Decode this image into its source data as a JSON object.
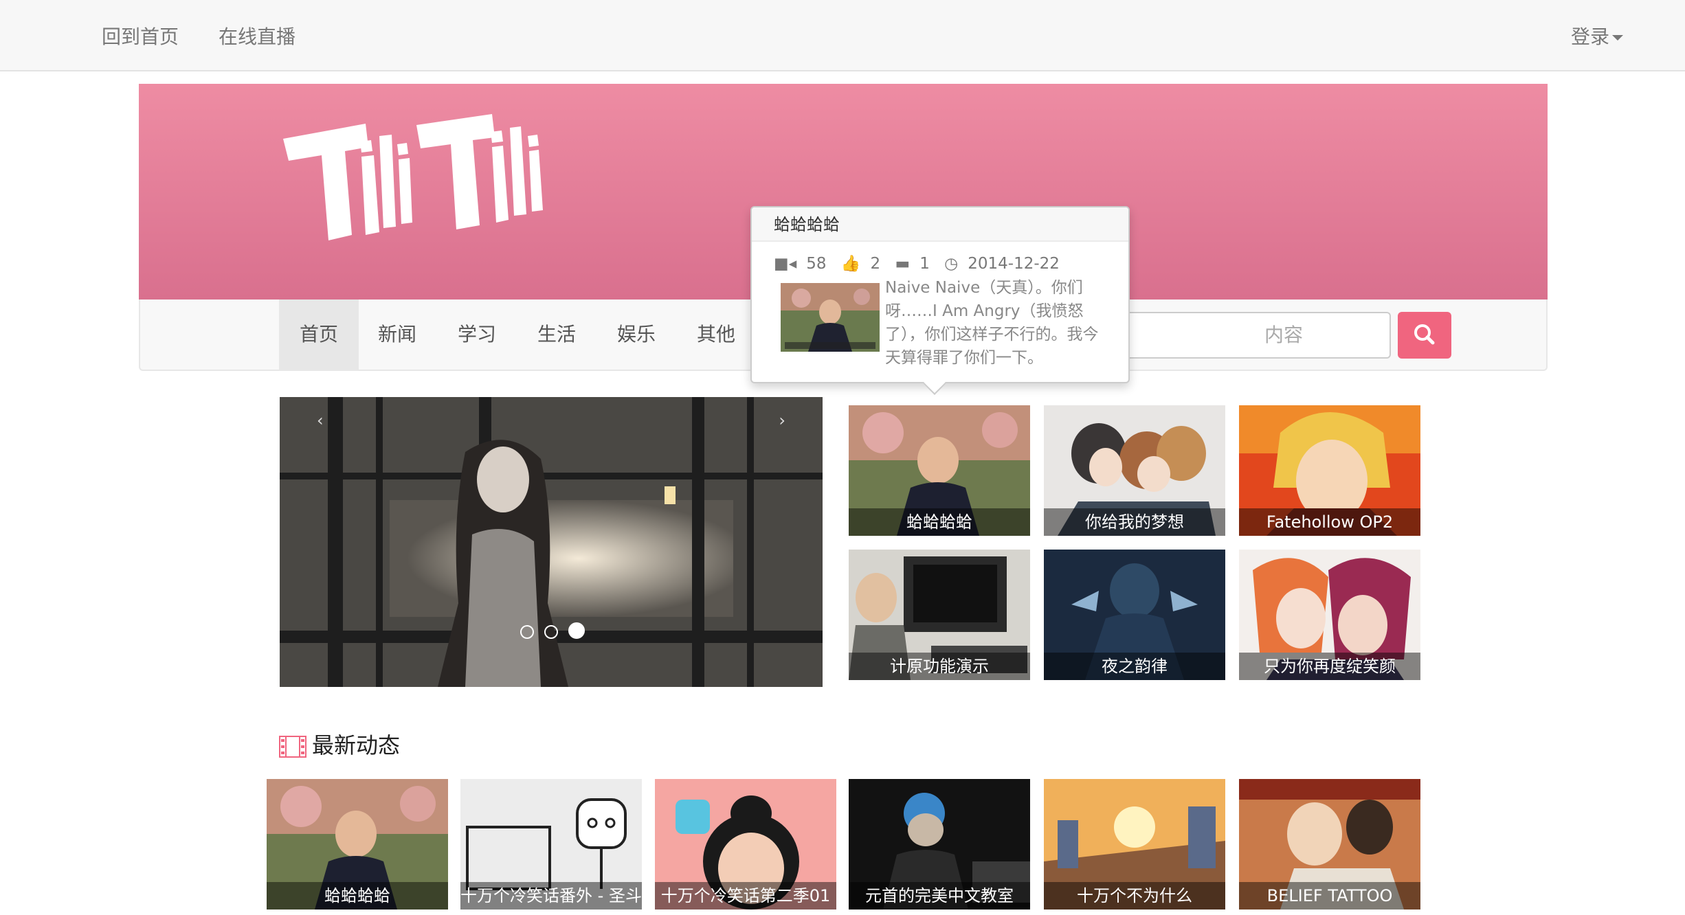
{
  "topbar": {
    "home": "回到首页",
    "live": "在线直播",
    "login": "登录"
  },
  "brand": {
    "logo_text": "TiliTili",
    "accent": "#f0657f"
  },
  "categories": [
    "首页",
    "新闻",
    "学习",
    "生活",
    "娱乐",
    "其他"
  ],
  "search": {
    "placeholder_visible": "内容"
  },
  "popover": {
    "title": "蛤蛤蛤蛤",
    "views": "58",
    "likes": "2",
    "comments": "1",
    "date": "2014-12-22",
    "description": "Naive Naive（天真）。你们呀……I Am Angry（我愤怒了），你们这样子不行的。我今天算得罪了你们一下。"
  },
  "featured": [
    {
      "title": "蛤蛤蛤蛤"
    },
    {
      "title": "你给我的梦想"
    },
    {
      "title": "Fatehollow OP2"
    },
    {
      "title": "计原功能演示"
    },
    {
      "title": "夜之韵律"
    },
    {
      "title": "只为你再度绽笑颜"
    }
  ],
  "latest": {
    "heading": "最新动态",
    "items": [
      {
        "title": "蛤蛤蛤蛤"
      },
      {
        "title": "十万个冷笑话番外 - 圣斗"
      },
      {
        "title": "十万个冷笑话第二季01"
      },
      {
        "title": "元首的完美中文教室"
      },
      {
        "title": "十万个不为什么"
      },
      {
        "title": "BELIEF TATTOO"
      }
    ]
  },
  "carousel": {
    "slides": 3,
    "active_slide": 3
  }
}
